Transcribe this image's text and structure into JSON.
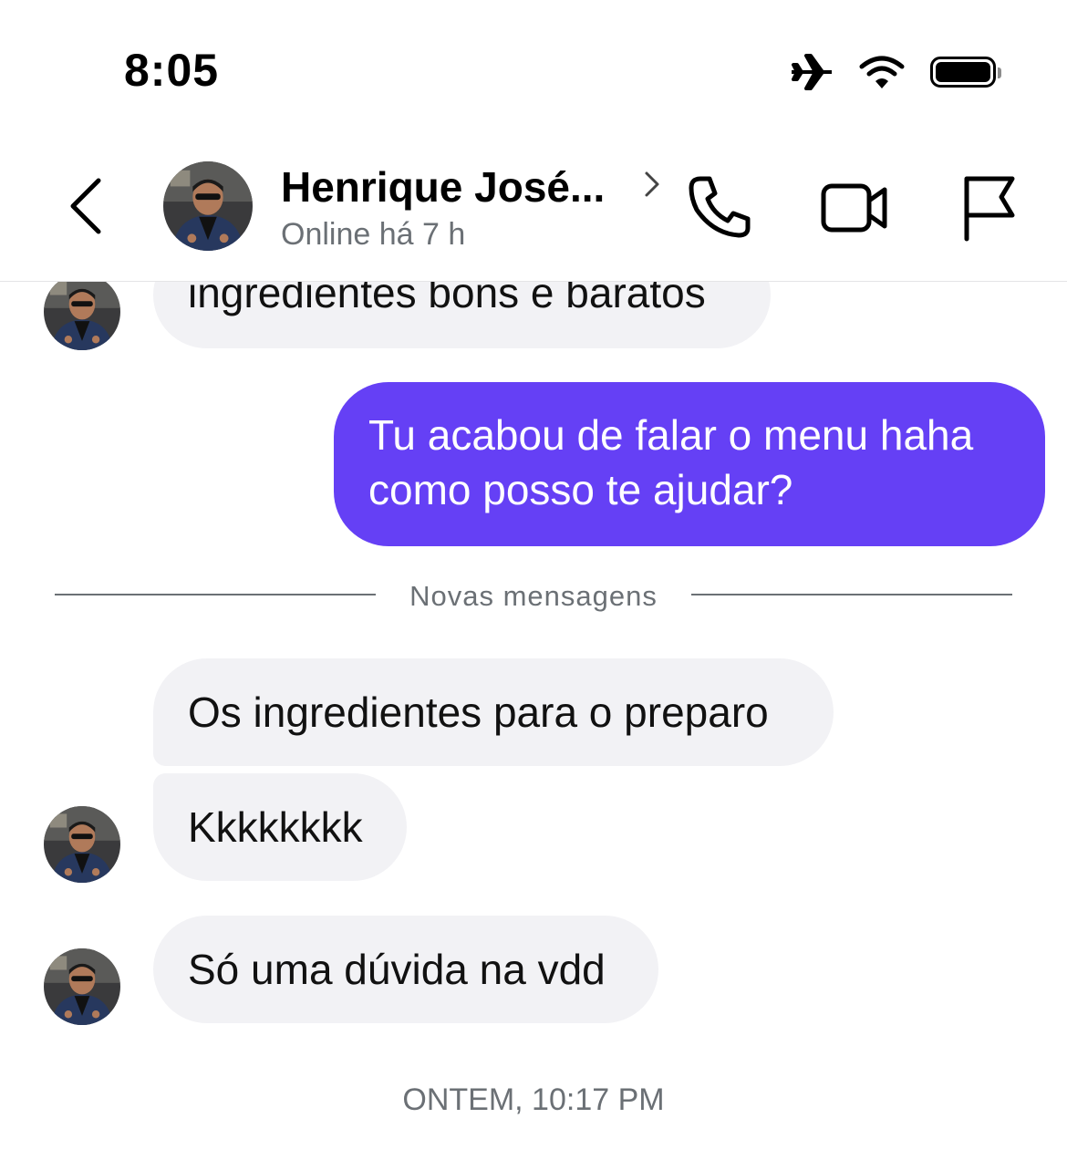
{
  "status_bar": {
    "time": "8:05"
  },
  "header": {
    "contact_name": "Henrique José...",
    "presence": "Online há 7 h"
  },
  "messages": [
    {
      "direction": "in",
      "text": "ingredientes bons e baratos",
      "show_avatar": true
    },
    {
      "direction": "out",
      "text": "Tu acabou de falar o menu haha como posso te ajudar?"
    },
    {
      "direction": "in",
      "text": "Os ingredientes para o preparo",
      "show_avatar": false
    },
    {
      "direction": "in",
      "text": "Kkkkkkkk",
      "show_avatar": true
    },
    {
      "direction": "in",
      "text": "Só uma dúvida na vdd",
      "show_avatar": true
    }
  ],
  "divider": {
    "label": "Novas mensagens"
  },
  "timestamp": "ONTEM, 10:17 PM",
  "colors": {
    "accent": "#6540f5",
    "incoming_bubble": "#f2f2f5",
    "muted_text": "#6b7075"
  }
}
